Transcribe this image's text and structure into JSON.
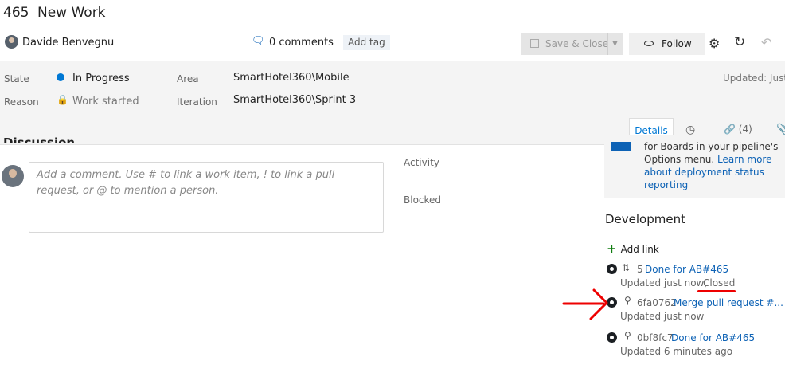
{
  "header": {
    "work_item_id": "465",
    "title": "New Work",
    "author": "Davide Benvegnu",
    "comments": "0 comments",
    "add_tag": "Add tag",
    "save_close": "Save & Close",
    "follow": "Follow"
  },
  "fields": {
    "state_label": "State",
    "state_value": "In Progress",
    "reason_label": "Reason",
    "reason_value": "Work started",
    "area_label": "Area",
    "area_value": "SmartHotel360\\Mobile",
    "iteration_label": "Iteration",
    "iteration_value": "SmartHotel360\\Sprint 3",
    "updated": "Updated: Just n"
  },
  "tabs": {
    "details": "Details",
    "links": "(4)"
  },
  "discussion": {
    "title": "Discussion",
    "placeholder": "Add a comment. Use # to link a work item, ! to link a pull request, or @ to mention a person."
  },
  "planning": {
    "activity_label": "Activity",
    "blocked_label": "Blocked"
  },
  "info_card": {
    "text1": "for Boards in your pipeline's",
    "text2": "Options menu.",
    "link1": "Learn more",
    "link2": "about deployment status",
    "link3": "reporting"
  },
  "development": {
    "title": "Development",
    "add_link": "Add link",
    "items": [
      {
        "id": "5",
        "link": "Done for AB#465",
        "updated": "Updated just now,",
        "status": "Closed"
      },
      {
        "id": "6fa0762",
        "link": "Merge pull request #...",
        "updated": "Updated just now"
      },
      {
        "id": "0bf8fc7",
        "link": "Done for AB#465",
        "updated": "Updated 6 minutes ago"
      }
    ]
  },
  "colors": {
    "accent": "#0078d4",
    "link": "#0d62b5",
    "annotation": "#ee0000"
  }
}
